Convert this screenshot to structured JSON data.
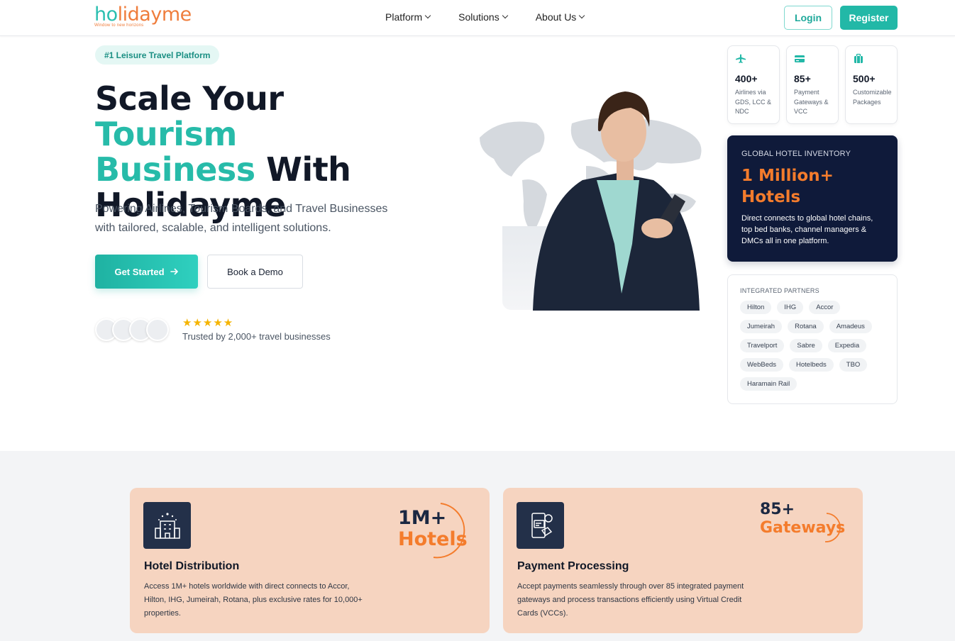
{
  "header": {
    "logo_main_a": "h",
    "logo_main_b": "o",
    "logo_main_c": "lidayme",
    "logo_tagline": "Window to new horizons",
    "nav": [
      "Platform",
      "Solutions",
      "About Us"
    ],
    "login_label": "Login",
    "register_label": "Register"
  },
  "hero": {
    "badge": "#1 Leisure Travel Platform",
    "title_part1": "Scale Your ",
    "title_highlight1": "Tourism",
    "title_highlight2": "Business",
    "title_part2": " With",
    "title_part3": "Holidayme",
    "subtitle": "Powering Airlines, Tourism Boards, and Travel Businesses with tailored, scalable, and intelligent solutions.",
    "cta_primary": "Get Started",
    "cta_secondary": "Book a Demo",
    "stars": "★★★★★",
    "trusted_text": "Trusted by 2,000+ travel businesses"
  },
  "stats": [
    {
      "icon": "plane-icon",
      "value": "400+",
      "label": "Airlines via GDS, LCC & NDC"
    },
    {
      "icon": "credit-card-icon",
      "value": "85+",
      "label": "Payment Gateways & VCC"
    },
    {
      "icon": "suitcase-icon",
      "value": "500+",
      "label": "Customizable Packages"
    }
  ],
  "hotel_card": {
    "caption": "GLOBAL HOTEL INVENTORY",
    "headline_line1": "1 Million+",
    "headline_line2": "Hotels",
    "description": "Direct connects to global hotel chains, top bed banks, channel managers & DMCs all in one platform."
  },
  "partners": {
    "caption": "INTEGRATED PARTNERS",
    "items": [
      "Hilton",
      "IHG",
      "Accor",
      "Jumeirah",
      "Rotana",
      "Amadeus",
      "Travelport",
      "Sabre",
      "Expedia",
      "WebBeds",
      "Hotelbeds",
      "TBO",
      "Haramain Rail"
    ]
  },
  "features": [
    {
      "icon": "hotel-building-icon",
      "title": "Hotel Distribution",
      "description": "Access 1M+ hotels worldwide with direct connects to Accor, Hilton, IHG, Jumeirah, Rotana, plus exclusive rates for 10,000+ properties.",
      "stat_top": "1M+",
      "stat_bottom": "Hotels"
    },
    {
      "icon": "payment-device-icon",
      "title": "Payment Processing",
      "description": "Accept payments seamlessly through over 85 integrated payment gateways and process transactions efficiently using Virtual Credit Cards (VCCs).",
      "stat_top": "85+",
      "stat_bottom": "Gateways"
    }
  ],
  "colors": {
    "teal": "#22b8a7",
    "orange": "#f47c2c",
    "navy": "#0f1a3a",
    "peach": "#f6d4c0"
  }
}
